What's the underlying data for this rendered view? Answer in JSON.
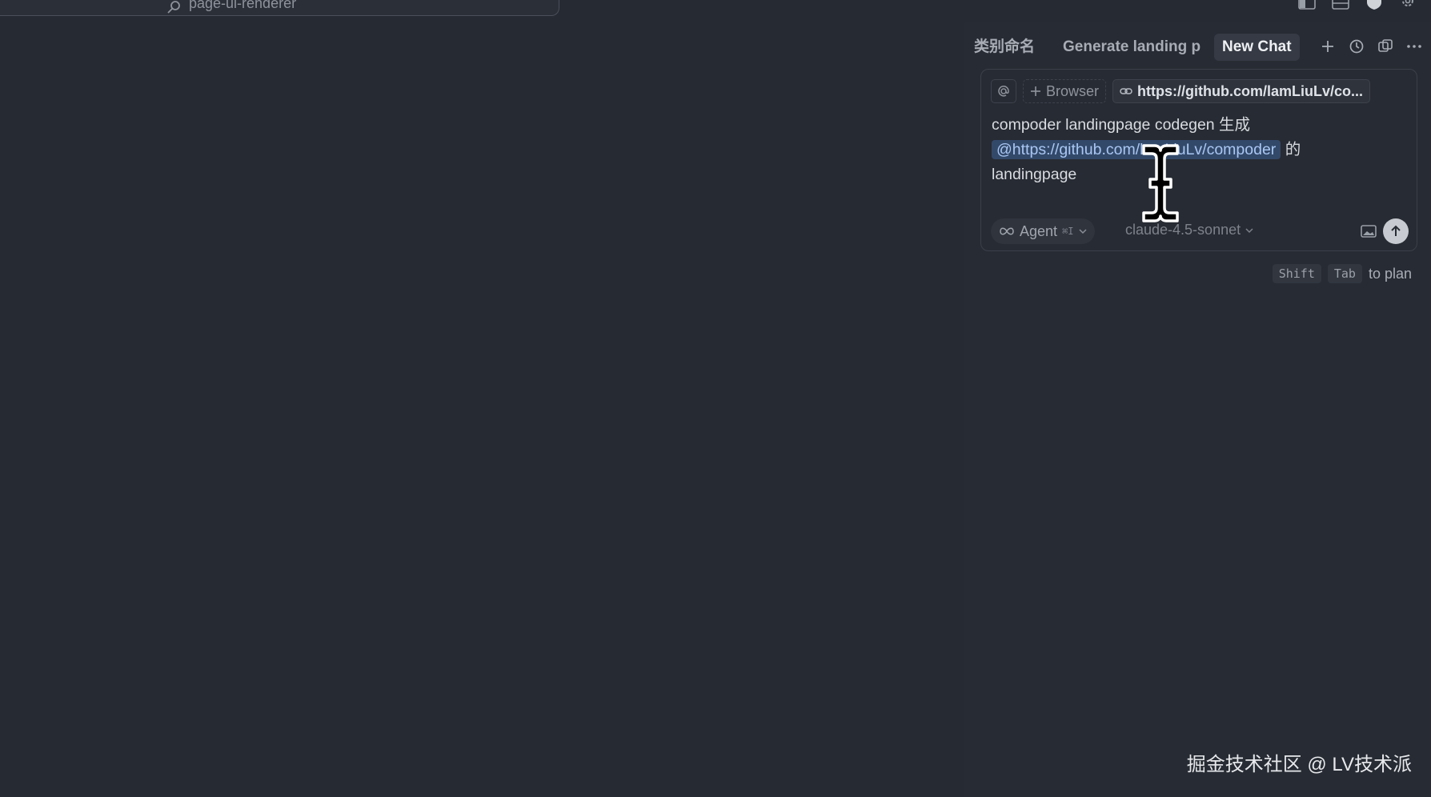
{
  "editor": {
    "search_label": "page-ui-renderer"
  },
  "chat": {
    "tabs": [
      {
        "label": "类别命名"
      },
      {
        "label": "Generate landing p"
      },
      {
        "label": "New Chat"
      }
    ],
    "context": {
      "browser_label": "Browser",
      "link_label": "https://github.com/lamLiuLv/co..."
    },
    "prompt": {
      "line1": "compoder landingpage codegen 生成",
      "mention": "@https://github.com/lamLiuLv/compoder",
      "suffix": " 的",
      "line3": "landingpage"
    },
    "mode": {
      "label": "Agent",
      "shortcut": "⌘I"
    },
    "model": "claude-4.5-sonnet",
    "hint": {
      "key1": "Shift",
      "key2": "Tab",
      "text": "to plan"
    }
  },
  "watermark": "掘金技术社区 @ LV技术派",
  "colors": {
    "background": "#262a33",
    "mention_bg": "#33496a",
    "mention_text": "#a9c7f3"
  }
}
